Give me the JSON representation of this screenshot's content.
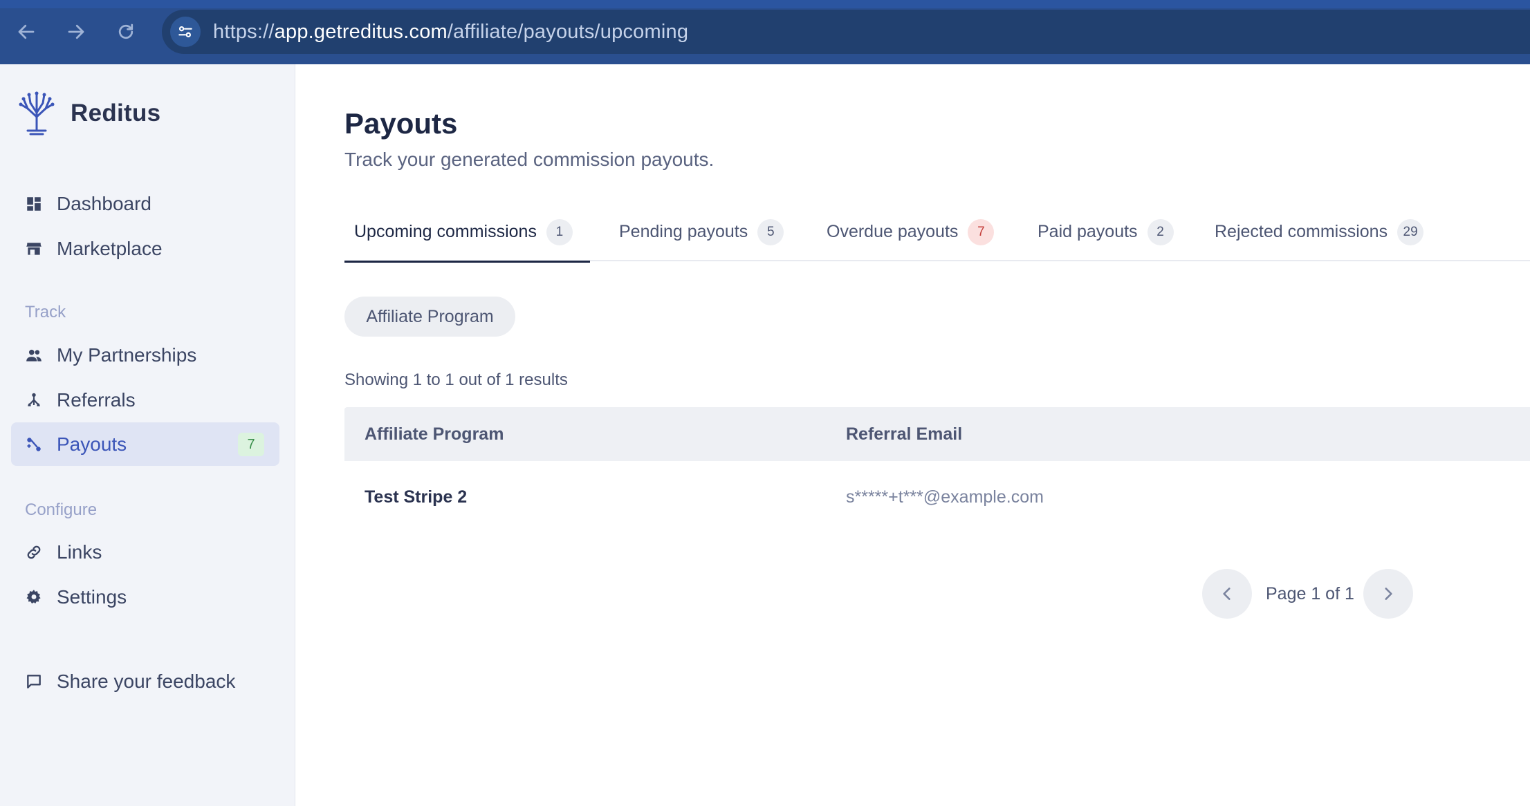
{
  "browser": {
    "url_scheme": "https://",
    "url_host": "app.getreditus.com",
    "url_path": "/affiliate/payouts/upcoming",
    "icons": {
      "back": "arrow-left-icon",
      "forward": "arrow-right-icon",
      "reload": "reload-icon",
      "site_info": "tune-icon"
    }
  },
  "sidebar": {
    "brand": "Reditus",
    "items_top": [
      {
        "label": "Dashboard",
        "icon": "dashboard-icon"
      },
      {
        "label": "Marketplace",
        "icon": "store-icon"
      }
    ],
    "section_track": "Track",
    "items_track": [
      {
        "label": "My Partnerships",
        "icon": "people-icon"
      },
      {
        "label": "Referrals",
        "icon": "network-icon"
      },
      {
        "label": "Payouts",
        "icon": "payouts-icon",
        "badge": "7",
        "active": true
      }
    ],
    "section_configure": "Configure",
    "items_configure": [
      {
        "label": "Links",
        "icon": "link-icon"
      },
      {
        "label": "Settings",
        "icon": "gear-icon"
      }
    ],
    "feedback": {
      "label": "Share your feedback",
      "icon": "feedback-icon"
    }
  },
  "main": {
    "title": "Payouts",
    "subtitle": "Track your generated commission payouts.",
    "tabs": [
      {
        "label": "Upcoming commissions",
        "count": "1",
        "active": true
      },
      {
        "label": "Pending payouts",
        "count": "5"
      },
      {
        "label": "Overdue payouts",
        "count": "7",
        "highlight": "red"
      },
      {
        "label": "Paid payouts",
        "count": "2"
      },
      {
        "label": "Rejected commissions",
        "count": "29"
      }
    ],
    "filter_chip": "Affiliate Program",
    "results_text": "Showing 1 to 1 out of 1 results",
    "table": {
      "columns": [
        "Affiliate Program",
        "Referral Email"
      ],
      "rows": [
        [
          "Test Stripe 2",
          "s*****+t***@example.com"
        ]
      ]
    },
    "pagination": {
      "text": "Page 1 of 1"
    }
  },
  "colors": {
    "chrome": "#2a4f8f",
    "url_bar": "#21406f",
    "sidebar_bg": "#f2f4f9",
    "active_item_bg": "#dfe4f4",
    "accent": "#3b55b8",
    "badge_green_bg": "#dcf3df",
    "badge_red_bg": "#fbe0df"
  }
}
